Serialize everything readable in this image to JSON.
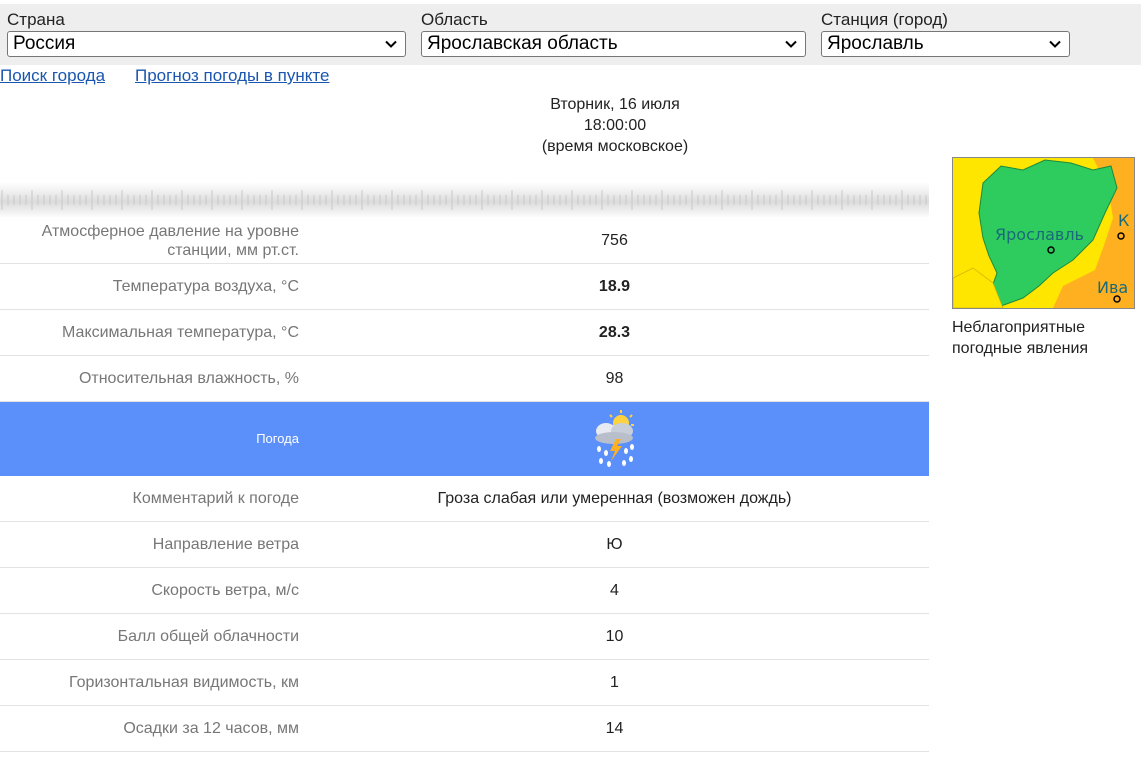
{
  "selectors": {
    "country": {
      "label": "Страна",
      "value": "Россия"
    },
    "region": {
      "label": "Область",
      "value": "Ярославская область"
    },
    "station": {
      "label": "Станция (город)",
      "value": "Ярославль"
    }
  },
  "links": {
    "city_search": "Поиск города",
    "point_forecast": "Прогноз погоды в пункте"
  },
  "datetime": {
    "day": "Вторник, 16 июля",
    "time": "18:00:00",
    "zone": "(время московское)"
  },
  "rows": [
    {
      "label": "Атмосферное давление на уровне станции, мм рт.ст.",
      "value": "756"
    },
    {
      "label": "Температура воздуха, °C",
      "value": "18.9"
    },
    {
      "label": "Максимальная температура, °C",
      "value": "28.3"
    },
    {
      "label": "Относительная влажность, %",
      "value": "98"
    }
  ],
  "weather_row": {
    "label": "Погода",
    "icon": "thunderstorm-rain-icon"
  },
  "rows2": [
    {
      "label": "Комментарий к погоде",
      "value": "Гроза слабая или умеренная (возможен дождь)"
    },
    {
      "label": "Направление ветра",
      "value": "Ю"
    },
    {
      "label": "Скорость ветра, м/с",
      "value": "4"
    },
    {
      "label": "Балл общей облачности",
      "value": "10"
    },
    {
      "label": "Горизонтальная видимость, км",
      "value": "1"
    },
    {
      "label": "Осадки за 12 часов, мм",
      "value": "14"
    }
  ],
  "map": {
    "city_label": "Ярославль",
    "edge_label_k": "К",
    "edge_label_iva": "Ива",
    "caption": "Неблагоприятные погодные явления",
    "colors": {
      "region": "#2ecc5e",
      "neighbor": "#ffe600",
      "orange": "#ffb020"
    }
  },
  "colors": {
    "weather_row": "#5b8ff9",
    "link": "#1a56b0"
  }
}
